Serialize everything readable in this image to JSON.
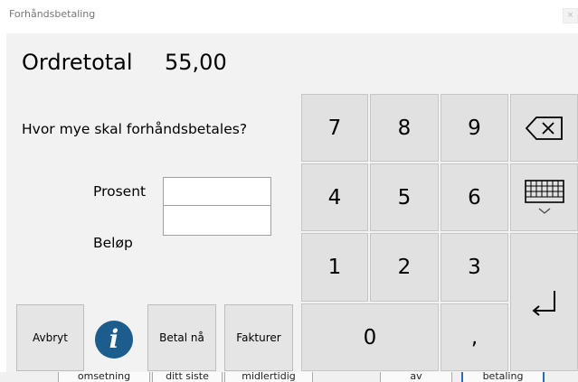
{
  "window": {
    "title": "Forhåndsbetaling",
    "close_glyph": "×"
  },
  "order": {
    "label": "Ordretotal",
    "value": "55,00"
  },
  "prompt": "Hvor mye skal forhåndsbetales?",
  "fields": {
    "prosent": {
      "label": "Prosent",
      "value": ""
    },
    "belop": {
      "label": "Beløp",
      "value": ""
    }
  },
  "buttons": {
    "cancel": "Avbryt",
    "info_glyph": "i",
    "pay_now": "Betal nå",
    "invoice": "Fakturer"
  },
  "keypad": {
    "k7": "7",
    "k8": "8",
    "k9": "9",
    "k4": "4",
    "k5": "5",
    "k6": "6",
    "k1": "1",
    "k2": "2",
    "k3": "3",
    "k0": "0",
    "comma": ",",
    "icons": {
      "backspace": "backspace-icon",
      "keyboard": "keyboard-icon",
      "enter": "enter-icon"
    }
  },
  "background_buttons": [
    "omsetning",
    "ditt siste",
    "midlertidig",
    "av",
    "betaling"
  ],
  "colors": {
    "panel": "#f2f2f2",
    "key": "#e1e1e1",
    "info_icon": "#1c5d8e",
    "accent_border": "#2a6bb8"
  }
}
